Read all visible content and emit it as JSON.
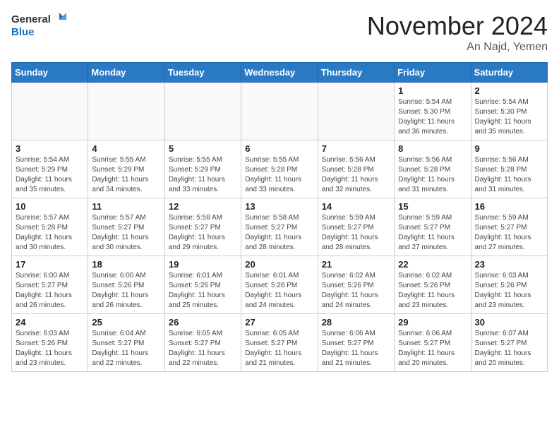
{
  "header": {
    "logo_general": "General",
    "logo_blue": "Blue",
    "month_title": "November 2024",
    "location": "An Najd, Yemen"
  },
  "weekdays": [
    "Sunday",
    "Monday",
    "Tuesday",
    "Wednesday",
    "Thursday",
    "Friday",
    "Saturday"
  ],
  "weeks": [
    [
      {
        "day": "",
        "info": ""
      },
      {
        "day": "",
        "info": ""
      },
      {
        "day": "",
        "info": ""
      },
      {
        "day": "",
        "info": ""
      },
      {
        "day": "",
        "info": ""
      },
      {
        "day": "1",
        "info": "Sunrise: 5:54 AM\nSunset: 5:30 PM\nDaylight: 11 hours\nand 36 minutes."
      },
      {
        "day": "2",
        "info": "Sunrise: 5:54 AM\nSunset: 5:30 PM\nDaylight: 11 hours\nand 35 minutes."
      }
    ],
    [
      {
        "day": "3",
        "info": "Sunrise: 5:54 AM\nSunset: 5:29 PM\nDaylight: 11 hours\nand 35 minutes."
      },
      {
        "day": "4",
        "info": "Sunrise: 5:55 AM\nSunset: 5:29 PM\nDaylight: 11 hours\nand 34 minutes."
      },
      {
        "day": "5",
        "info": "Sunrise: 5:55 AM\nSunset: 5:29 PM\nDaylight: 11 hours\nand 33 minutes."
      },
      {
        "day": "6",
        "info": "Sunrise: 5:55 AM\nSunset: 5:28 PM\nDaylight: 11 hours\nand 33 minutes."
      },
      {
        "day": "7",
        "info": "Sunrise: 5:56 AM\nSunset: 5:28 PM\nDaylight: 11 hours\nand 32 minutes."
      },
      {
        "day": "8",
        "info": "Sunrise: 5:56 AM\nSunset: 5:28 PM\nDaylight: 11 hours\nand 31 minutes."
      },
      {
        "day": "9",
        "info": "Sunrise: 5:56 AM\nSunset: 5:28 PM\nDaylight: 11 hours\nand 31 minutes."
      }
    ],
    [
      {
        "day": "10",
        "info": "Sunrise: 5:57 AM\nSunset: 5:28 PM\nDaylight: 11 hours\nand 30 minutes."
      },
      {
        "day": "11",
        "info": "Sunrise: 5:57 AM\nSunset: 5:27 PM\nDaylight: 11 hours\nand 30 minutes."
      },
      {
        "day": "12",
        "info": "Sunrise: 5:58 AM\nSunset: 5:27 PM\nDaylight: 11 hours\nand 29 minutes."
      },
      {
        "day": "13",
        "info": "Sunrise: 5:58 AM\nSunset: 5:27 PM\nDaylight: 11 hours\nand 28 minutes."
      },
      {
        "day": "14",
        "info": "Sunrise: 5:59 AM\nSunset: 5:27 PM\nDaylight: 11 hours\nand 28 minutes."
      },
      {
        "day": "15",
        "info": "Sunrise: 5:59 AM\nSunset: 5:27 PM\nDaylight: 11 hours\nand 27 minutes."
      },
      {
        "day": "16",
        "info": "Sunrise: 5:59 AM\nSunset: 5:27 PM\nDaylight: 11 hours\nand 27 minutes."
      }
    ],
    [
      {
        "day": "17",
        "info": "Sunrise: 6:00 AM\nSunset: 5:27 PM\nDaylight: 11 hours\nand 26 minutes."
      },
      {
        "day": "18",
        "info": "Sunrise: 6:00 AM\nSunset: 5:26 PM\nDaylight: 11 hours\nand 26 minutes."
      },
      {
        "day": "19",
        "info": "Sunrise: 6:01 AM\nSunset: 5:26 PM\nDaylight: 11 hours\nand 25 minutes."
      },
      {
        "day": "20",
        "info": "Sunrise: 6:01 AM\nSunset: 5:26 PM\nDaylight: 11 hours\nand 24 minutes."
      },
      {
        "day": "21",
        "info": "Sunrise: 6:02 AM\nSunset: 5:26 PM\nDaylight: 11 hours\nand 24 minutes."
      },
      {
        "day": "22",
        "info": "Sunrise: 6:02 AM\nSunset: 5:26 PM\nDaylight: 11 hours\nand 23 minutes."
      },
      {
        "day": "23",
        "info": "Sunrise: 6:03 AM\nSunset: 5:26 PM\nDaylight: 11 hours\nand 23 minutes."
      }
    ],
    [
      {
        "day": "24",
        "info": "Sunrise: 6:03 AM\nSunset: 5:26 PM\nDaylight: 11 hours\nand 23 minutes."
      },
      {
        "day": "25",
        "info": "Sunrise: 6:04 AM\nSunset: 5:27 PM\nDaylight: 11 hours\nand 22 minutes."
      },
      {
        "day": "26",
        "info": "Sunrise: 6:05 AM\nSunset: 5:27 PM\nDaylight: 11 hours\nand 22 minutes."
      },
      {
        "day": "27",
        "info": "Sunrise: 6:05 AM\nSunset: 5:27 PM\nDaylight: 11 hours\nand 21 minutes."
      },
      {
        "day": "28",
        "info": "Sunrise: 6:06 AM\nSunset: 5:27 PM\nDaylight: 11 hours\nand 21 minutes."
      },
      {
        "day": "29",
        "info": "Sunrise: 6:06 AM\nSunset: 5:27 PM\nDaylight: 11 hours\nand 20 minutes."
      },
      {
        "day": "30",
        "info": "Sunrise: 6:07 AM\nSunset: 5:27 PM\nDaylight: 11 hours\nand 20 minutes."
      }
    ]
  ]
}
